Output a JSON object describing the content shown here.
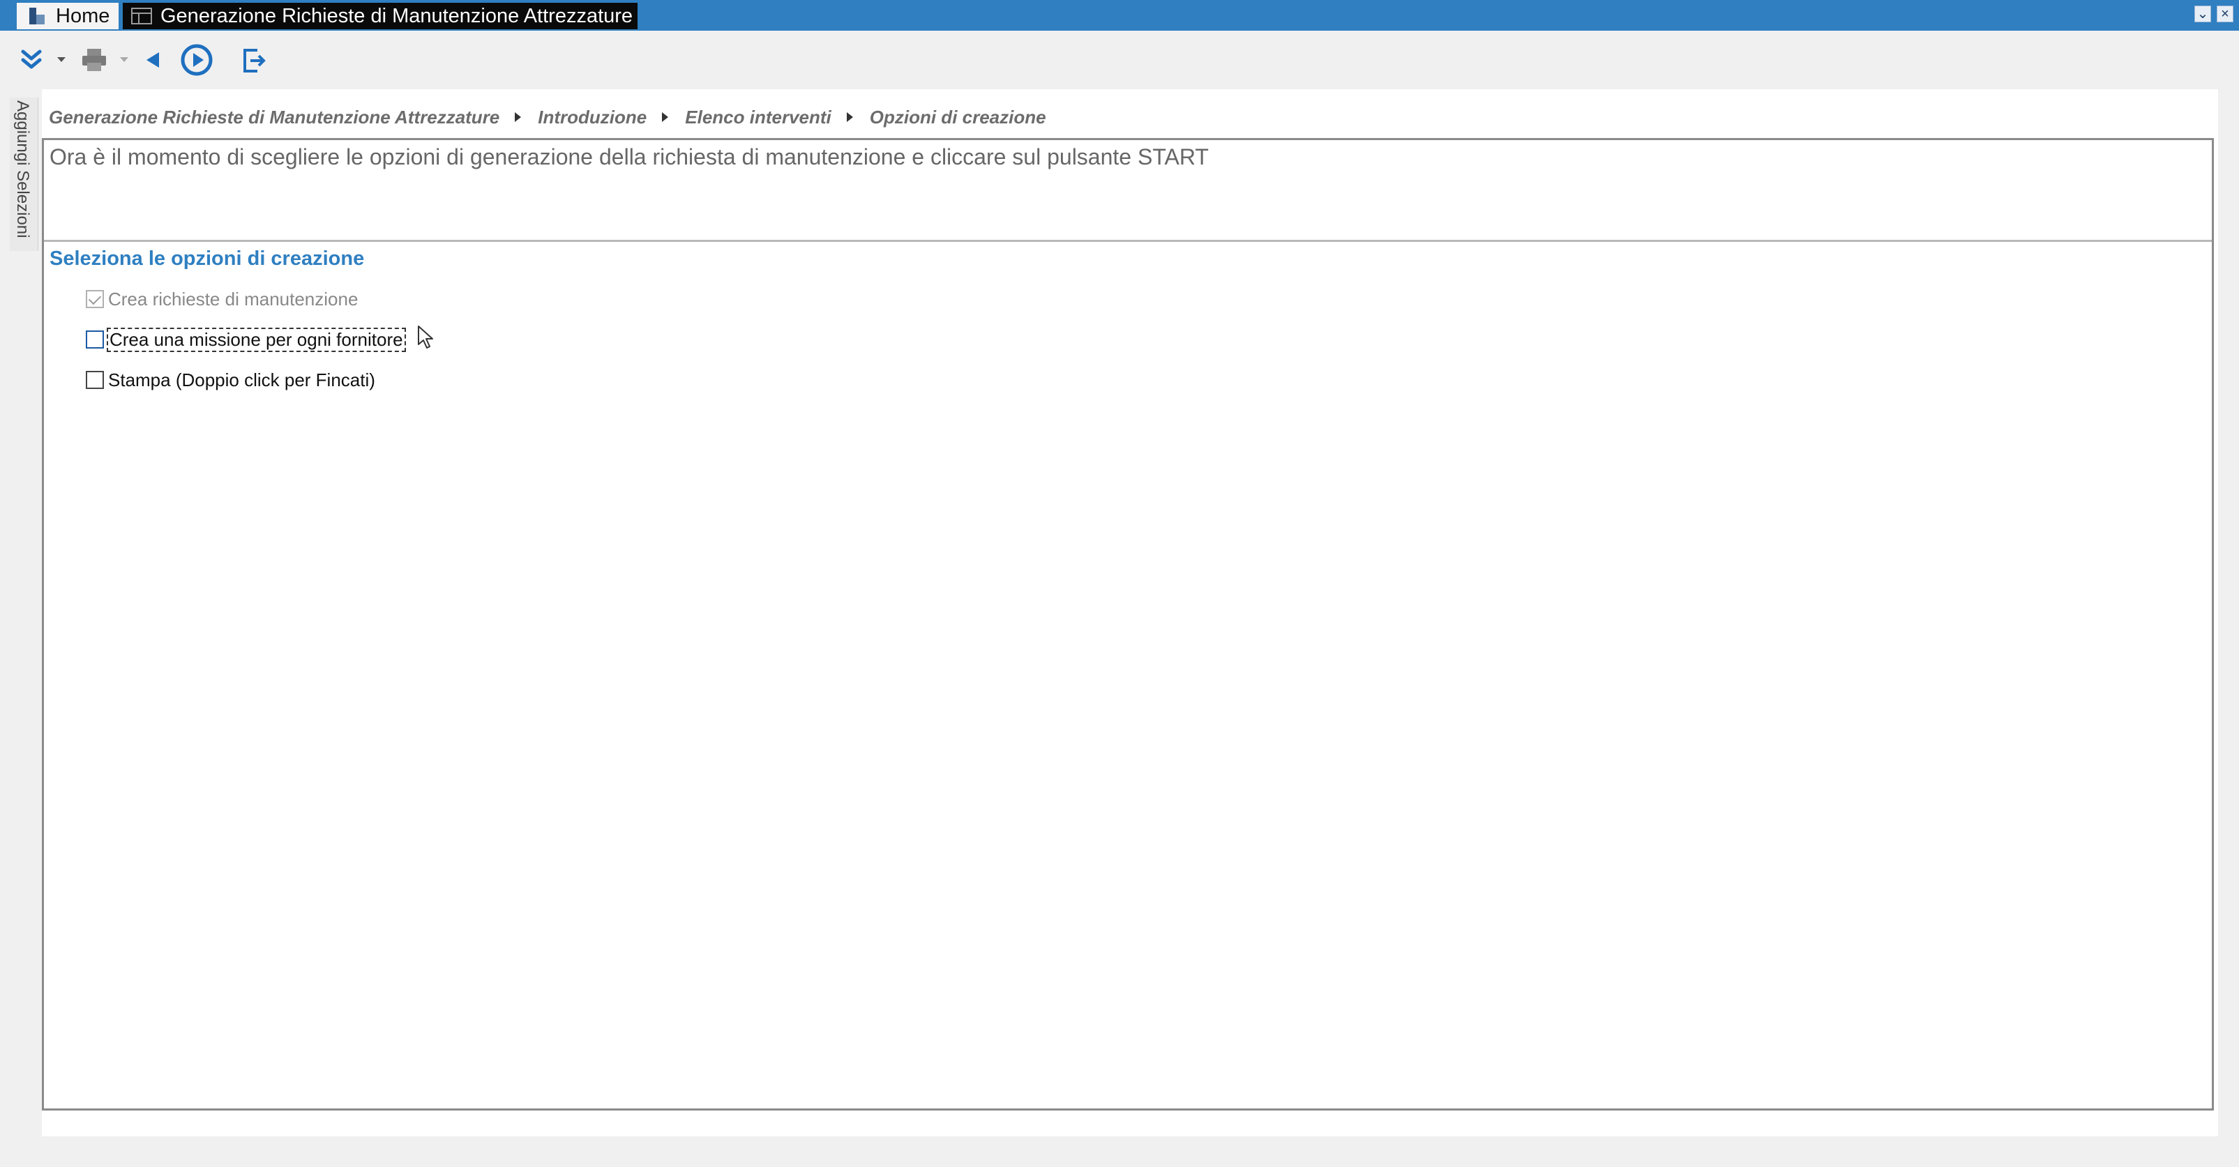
{
  "tabs": {
    "home_label": "Home",
    "active_label": "Generazione Richieste di Manutenzione Attrezzature"
  },
  "window": {
    "minimize_glyph": "⌄",
    "close_glyph": "×"
  },
  "toolbar": {
    "icons": [
      "expand-all-icon",
      "print-icon",
      "back-icon",
      "start-icon",
      "exit-icon"
    ]
  },
  "side_panel": {
    "label": "Aggiungi Selezioni"
  },
  "breadcrumb": {
    "items": [
      "Generazione Richieste di Manutenzione Attrezzature",
      "Introduzione",
      "Elenco interventi",
      "Opzioni di creazione"
    ]
  },
  "intro": {
    "text": "Ora è il momento di scegliere le opzioni di generazione della richiesta di manutenzione e cliccare sul pulsante START"
  },
  "options": {
    "title": "Seleziona le opzioni di creazione",
    "items": [
      {
        "label": "Crea richieste di manutenzione",
        "checked": true,
        "enabled": false
      },
      {
        "label": "Crea una missione per ogni fornitore",
        "checked": false,
        "enabled": true,
        "focused": true
      },
      {
        "label": "Stampa (Doppio click per Fincati)",
        "checked": false,
        "enabled": true
      }
    ]
  },
  "colors": {
    "titlebar": "#2f7fc1",
    "accent": "#2f7fc1",
    "active_tab": "#0a0a0a",
    "border": "#8a8a8a"
  }
}
